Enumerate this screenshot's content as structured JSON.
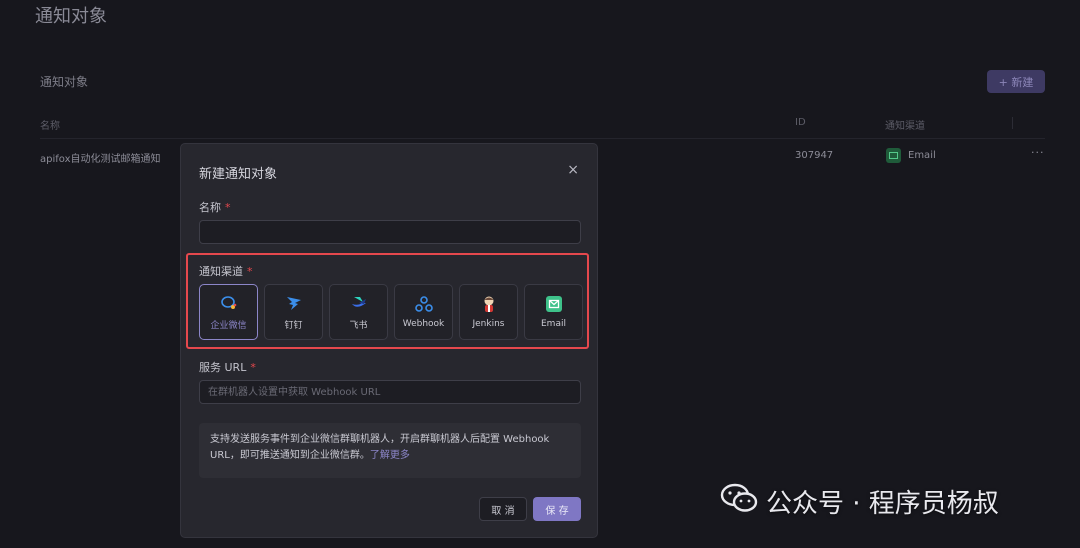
{
  "page": {
    "title": "通知对象"
  },
  "section": {
    "title": "通知对象",
    "new_button_label": "+ 新建"
  },
  "table": {
    "headers": {
      "name": "名称",
      "id": "ID",
      "channel": "通知渠道"
    },
    "rows": [
      {
        "name": "apifox自动化测试邮箱通知",
        "id": "307947",
        "channel": "Email",
        "more": "···"
      }
    ]
  },
  "modal": {
    "title": "新建通知对象",
    "close_glyph": "×",
    "name_label": "名称",
    "name_value": "",
    "required_mark": "*",
    "channel_label": "通知渠道",
    "channels": [
      {
        "label": "企业微信",
        "icon": "wecom-icon",
        "selected": true
      },
      {
        "label": "钉钉",
        "icon": "dingtalk-icon",
        "selected": false
      },
      {
        "label": "飞书",
        "icon": "feishu-icon",
        "selected": false
      },
      {
        "label": "Webhook",
        "icon": "webhook-icon",
        "selected": false
      },
      {
        "label": "Jenkins",
        "icon": "jenkins-icon",
        "selected": false
      },
      {
        "label": "Email",
        "icon": "email-icon",
        "selected": false
      }
    ],
    "url_label": "服务 URL",
    "url_placeholder": "在群机器人设置中获取 Webhook URL",
    "info_text": "支持发送服务事件到企业微信群聊机器人，开启群聊机器人后配置 Webhook URL，即可推送通知到企业微信群。",
    "info_link": "了解更多",
    "cancel_label": "取 消",
    "save_label": "保 存"
  },
  "watermark": {
    "text": "公众号 · 程序员杨叔"
  },
  "colors": {
    "accent": "#7f77c4",
    "highlight": "#e5484d",
    "email_green": "#55c98a"
  }
}
